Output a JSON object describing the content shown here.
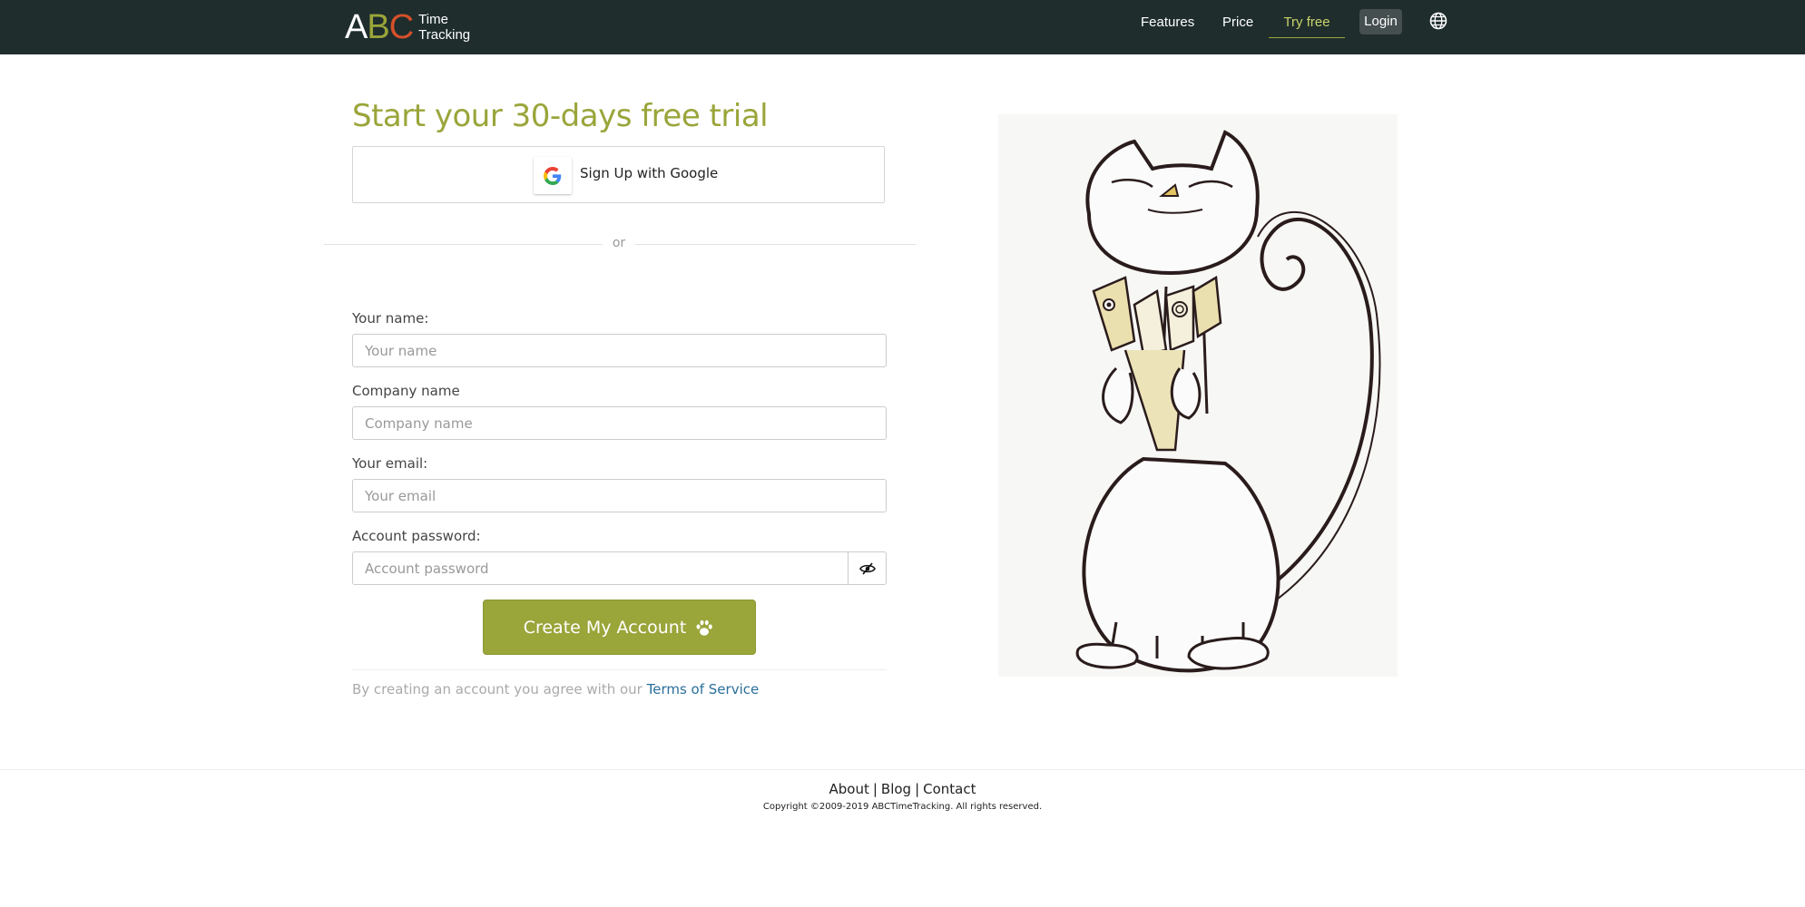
{
  "header": {
    "logo": {
      "letter_a": "A",
      "letter_b": "B",
      "letter_c": "C",
      "line1": "Time",
      "line2": "Tracking"
    },
    "nav": {
      "features": "Features",
      "price": "Price",
      "try_free": "Try free",
      "login": "Login"
    },
    "language_icon": "globe-icon"
  },
  "form": {
    "title": "Start your 30-days free trial",
    "google_button": "Sign Up with Google",
    "divider_text": "or",
    "fields": {
      "name": {
        "label": "Your name:",
        "placeholder": "Your name",
        "value": ""
      },
      "company": {
        "label": "Company name",
        "placeholder": "Company name",
        "value": ""
      },
      "email": {
        "label": "Your email:",
        "placeholder": "Your email",
        "value": ""
      },
      "password": {
        "label": "Account password:",
        "placeholder": "Account password",
        "value": ""
      }
    },
    "submit_label": "Create My Account",
    "terms_prefix": "By creating an account you agree with our",
    "terms_link": "Terms of Service"
  },
  "footer": {
    "links": [
      "About",
      "Blog",
      "Contact"
    ],
    "separator": "|",
    "copyright": "Copyright ©2009-2019 ABCTimeTracking. All rights reserved."
  },
  "colors": {
    "header_bg": "#1f2d2d",
    "accent_green": "#9aa53a",
    "link_blue": "#2a6f9a"
  }
}
